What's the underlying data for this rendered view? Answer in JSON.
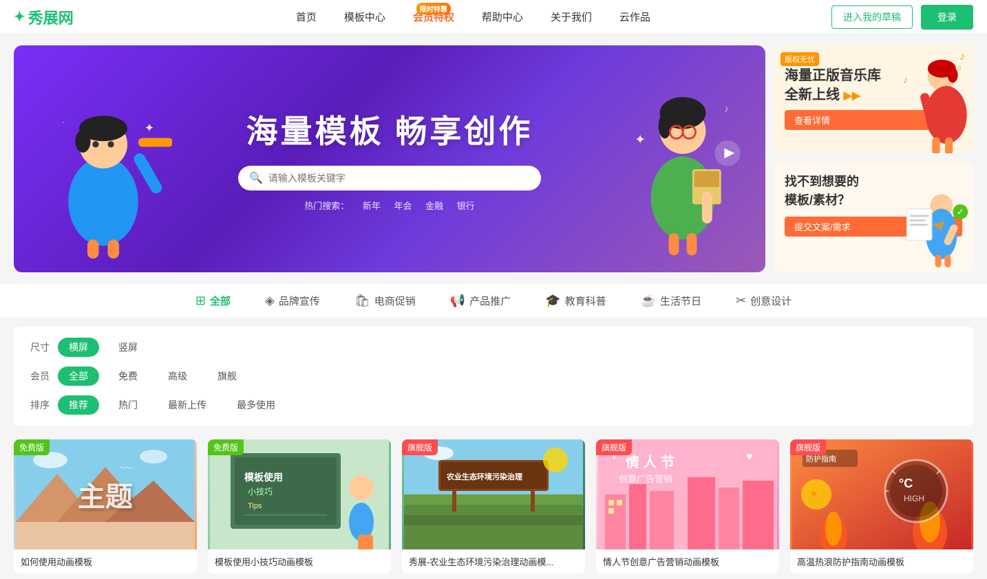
{
  "site": {
    "logo": "秀展网",
    "logo_icon": "✦"
  },
  "header": {
    "nav": [
      {
        "id": "home",
        "label": "首页",
        "active": false,
        "badge": null
      },
      {
        "id": "templates",
        "label": "模板中心",
        "active": false,
        "badge": null
      },
      {
        "id": "membership",
        "label": "会员特权",
        "active": false,
        "badge": "限时特惠"
      },
      {
        "id": "help",
        "label": "帮助中心",
        "active": false,
        "badge": null
      },
      {
        "id": "about",
        "label": "关于我们",
        "active": false,
        "badge": null
      },
      {
        "id": "cloud",
        "label": "云作品",
        "active": false,
        "badge": null
      }
    ],
    "btn_draft": "进入我的草稿",
    "btn_login": "登录"
  },
  "hero": {
    "title": "海量模板  畅享创作",
    "search_placeholder": "请输入模板关键字",
    "hot_label": "热门搜索：",
    "hot_items": [
      "新年",
      "年会",
      "金融",
      "银行"
    ]
  },
  "sidebar_ads": [
    {
      "id": "music",
      "badge": "版权无忧",
      "title": "海量正版音乐库\n全新上线",
      "btn_label": "查看详情",
      "bg": "#fef5e4"
    },
    {
      "id": "request",
      "title": "找不到想要的\n模板/素材？",
      "btn_label": "提交文案/需求",
      "bg": "#fff3e0"
    }
  ],
  "categories": [
    {
      "id": "all",
      "label": "全部",
      "icon": "grid",
      "active": true
    },
    {
      "id": "brand",
      "label": "品牌宣传",
      "icon": "diamond",
      "active": false
    },
    {
      "id": "ecommerce",
      "label": "电商促销",
      "icon": "bag",
      "active": false
    },
    {
      "id": "product",
      "label": "产品推广",
      "icon": "megaphone",
      "active": false
    },
    {
      "id": "education",
      "label": "教育科普",
      "icon": "graduation",
      "active": false
    },
    {
      "id": "lifestyle",
      "label": "生活节日",
      "icon": "cup",
      "active": false
    },
    {
      "id": "creative",
      "label": "创意设计",
      "icon": "scissors",
      "active": false
    }
  ],
  "filters": [
    {
      "id": "size",
      "label": "尺寸",
      "options": [
        {
          "label": "横屏",
          "active": true
        },
        {
          "label": "竖屏",
          "active": false
        }
      ]
    },
    {
      "id": "membership",
      "label": "会员",
      "options": [
        {
          "label": "全部",
          "active": true
        },
        {
          "label": "免费",
          "active": false
        },
        {
          "label": "高级",
          "active": false
        },
        {
          "label": "旗舰",
          "active": false
        }
      ]
    },
    {
      "id": "sort",
      "label": "排序",
      "options": [
        {
          "label": "推荐",
          "active": true
        },
        {
          "label": "热门",
          "active": false
        },
        {
          "label": "最新上传",
          "active": false
        },
        {
          "label": "最多使用",
          "active": false
        }
      ]
    }
  ],
  "templates": [
    {
      "id": "t1",
      "badge": "免费版",
      "badge_type": "free",
      "title": "如何使用动画模板",
      "thumb_type": "1",
      "thumb_text": "主题"
    },
    {
      "id": "t2",
      "badge": "免费版",
      "badge_type": "free",
      "title": "模板使用小技巧动画模板",
      "thumb_type": "2",
      "thumb_text": "模板使用\n小技巧 Tips"
    },
    {
      "id": "t3",
      "badge": "旗舰版",
      "badge_type": "flagship",
      "title": "秀展-农业生态环境污染治理动画模...",
      "thumb_type": "3",
      "thumb_text": "农业生态环境污染治理"
    },
    {
      "id": "t4",
      "badge": "旗舰版",
      "badge_type": "flagship",
      "title": "情人节创意广告营销动画模板",
      "thumb_type": "4",
      "thumb_text": "情人节\n创意广告营销"
    },
    {
      "id": "t5",
      "badge": "旗舰版",
      "badge_type": "flagship",
      "title": "高温热浪防护指南动画模板",
      "thumb_type": "5",
      "thumb_text": "防护指南"
    }
  ]
}
